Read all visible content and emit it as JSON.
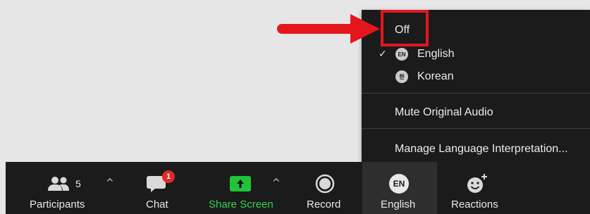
{
  "menu": {
    "off_label": "Off",
    "languages": [
      {
        "code": "EN",
        "label": "English",
        "checked": true
      },
      {
        "code": "한",
        "label": "Korean",
        "checked": false
      }
    ],
    "check_glyph": "✓",
    "mute_label": "Mute Original Audio",
    "manage_label": "Manage Language Interpretation..."
  },
  "toolbar": {
    "participants": {
      "label": "Participants",
      "count": "5",
      "icon": "participants-icon"
    },
    "chat": {
      "label": "Chat",
      "badge": "1",
      "icon": "chat-bubble-icon"
    },
    "share": {
      "label": "Share Screen",
      "icon": "share-screen-icon"
    },
    "record": {
      "label": "Record",
      "icon": "record-icon"
    },
    "interpretation": {
      "label": "English",
      "code": "EN"
    },
    "reactions": {
      "label": "Reactions",
      "icon": "smiley-add-icon"
    },
    "caret_glyph": "^"
  },
  "colors": {
    "toolbar_bg": "#1b1b1b",
    "share_green": "#1fc43a",
    "badge_red": "#e02828",
    "annotation_red": "#e3161b",
    "page_bg": "#e6e6e6"
  }
}
